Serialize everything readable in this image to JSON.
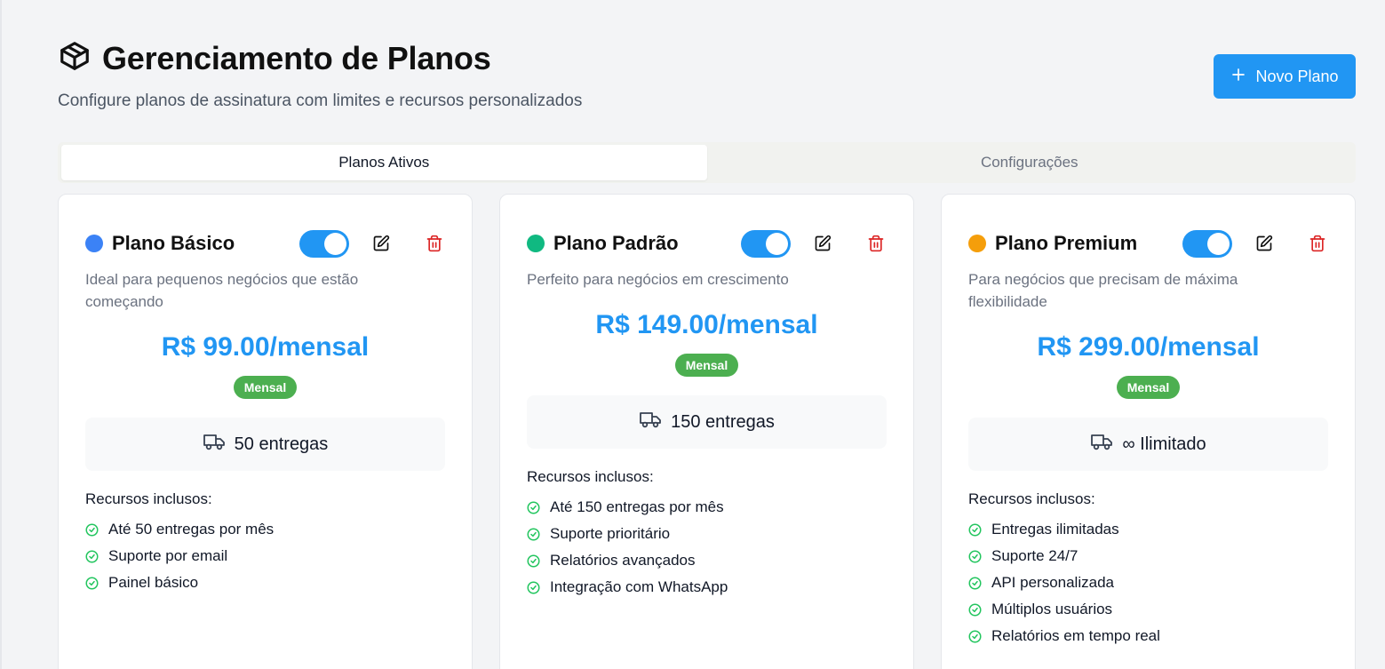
{
  "header": {
    "title": "Gerenciamento de Planos",
    "subtitle": "Configure planos de assinatura com limites e recursos personalizados",
    "new_button_label": "Novo Plano"
  },
  "tabs": [
    {
      "label": "Planos Ativos",
      "active": true
    },
    {
      "label": "Configurações",
      "active": false
    }
  ],
  "colors": {
    "accent": "#2196f3",
    "badge_green": "#4caf50",
    "delete_red": "#dc2626",
    "check_green": "#22c55e"
  },
  "resources_title": "Recursos inclusos:",
  "plans": [
    {
      "name": "Plano Básico",
      "dot_color": "#3b82f6",
      "enabled": true,
      "description": "Ideal para pequenos negócios que estão começando",
      "price": "R$ 99.00/mensal",
      "billing_badge": "Mensal",
      "limit_text": "50 entregas",
      "features": [
        "Até 50 entregas por mês",
        "Suporte por email",
        "Painel básico"
      ]
    },
    {
      "name": "Plano Padrão",
      "dot_color": "#10b981",
      "enabled": true,
      "description": "Perfeito para negócios em crescimento",
      "price": "R$ 149.00/mensal",
      "billing_badge": "Mensal",
      "limit_text": "150 entregas",
      "features": [
        "Até 150 entregas por mês",
        "Suporte prioritário",
        "Relatórios avançados",
        "Integração com WhatsApp"
      ]
    },
    {
      "name": "Plano Premium",
      "dot_color": "#f59e0b",
      "enabled": true,
      "description": "Para negócios que precisam de máxima flexibilidade",
      "price": "R$ 299.00/mensal",
      "billing_badge": "Mensal",
      "limit_text": "∞ Ilimitado",
      "features": [
        "Entregas ilimitadas",
        "Suporte 24/7",
        "API personalizada",
        "Múltiplos usuários",
        "Relatórios em tempo real"
      ]
    }
  ]
}
